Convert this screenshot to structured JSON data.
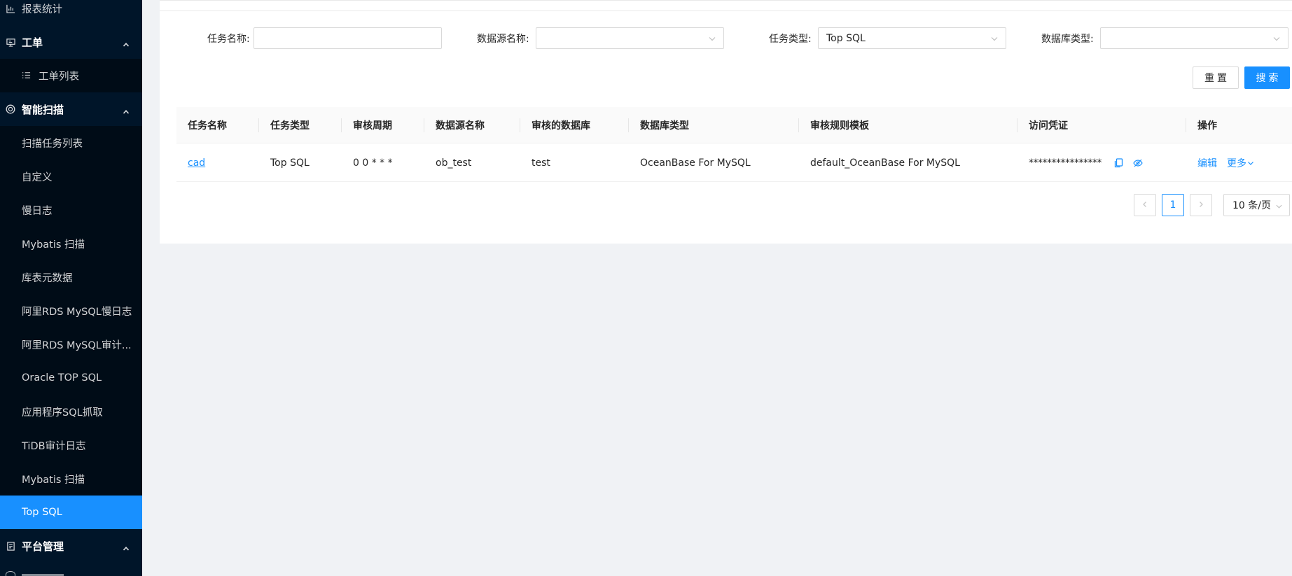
{
  "sidebar": {
    "items": [
      {
        "label": "报表统计",
        "kind": "item",
        "icon": "bar-chart-icon"
      },
      {
        "label": "工单",
        "kind": "group",
        "icon": "monitor-icon",
        "expanded": true
      },
      {
        "label": "工单列表",
        "kind": "subitem",
        "icon": "list-icon"
      },
      {
        "label": "智能扫描",
        "kind": "group",
        "icon": "scan-icon",
        "expanded": true
      },
      {
        "label": "扫描任务列表",
        "kind": "subitem"
      },
      {
        "label": "自定义",
        "kind": "subitem"
      },
      {
        "label": "慢日志",
        "kind": "subitem"
      },
      {
        "label": "Mybatis 扫描",
        "kind": "subitem"
      },
      {
        "label": "库表元数据",
        "kind": "subitem"
      },
      {
        "label": "阿里RDS MySQL慢日志",
        "kind": "subitem"
      },
      {
        "label": "阿里RDS MySQL审计...",
        "kind": "subitem"
      },
      {
        "label": "Oracle TOP SQL",
        "kind": "subitem"
      },
      {
        "label": "应用程序SQL抓取",
        "kind": "subitem"
      },
      {
        "label": "TiDB审计日志",
        "kind": "subitem"
      },
      {
        "label": "Mybatis 扫描",
        "kind": "subitem"
      },
      {
        "label": "Top SQL",
        "kind": "subitem",
        "active": true
      },
      {
        "label": "平台管理",
        "kind": "group",
        "icon": "document-icon",
        "expanded": true
      }
    ]
  },
  "filters": {
    "task_name_label": "任务名称:",
    "task_name_value": "",
    "datasource_label": "数据源名称:",
    "datasource_value": "",
    "task_type_label": "任务类型:",
    "task_type_value": "Top SQL",
    "db_type_label": "数据库类型:",
    "db_type_value": ""
  },
  "buttons": {
    "reset": "重置",
    "search": "搜索"
  },
  "table": {
    "headers": [
      "任务名称",
      "任务类型",
      "审核周期",
      "数据源名称",
      "审核的数据库",
      "数据库类型",
      "审核规则模板",
      "访问凭证",
      "操作"
    ],
    "rows": [
      {
        "name": "cad",
        "type": "Top SQL",
        "cron": "0 0 * * *",
        "datasource": "ob_test",
        "database": "test",
        "db_type": "OceanBase For MySQL",
        "template": "default_OceanBase For MySQL",
        "credential": "****************",
        "edit": "编辑",
        "more": "更多"
      }
    ]
  },
  "pagination": {
    "current": "1",
    "page_size": "10 条/页"
  },
  "colors": {
    "sidebar_bg": "#001529",
    "accent": "#1890ff"
  }
}
